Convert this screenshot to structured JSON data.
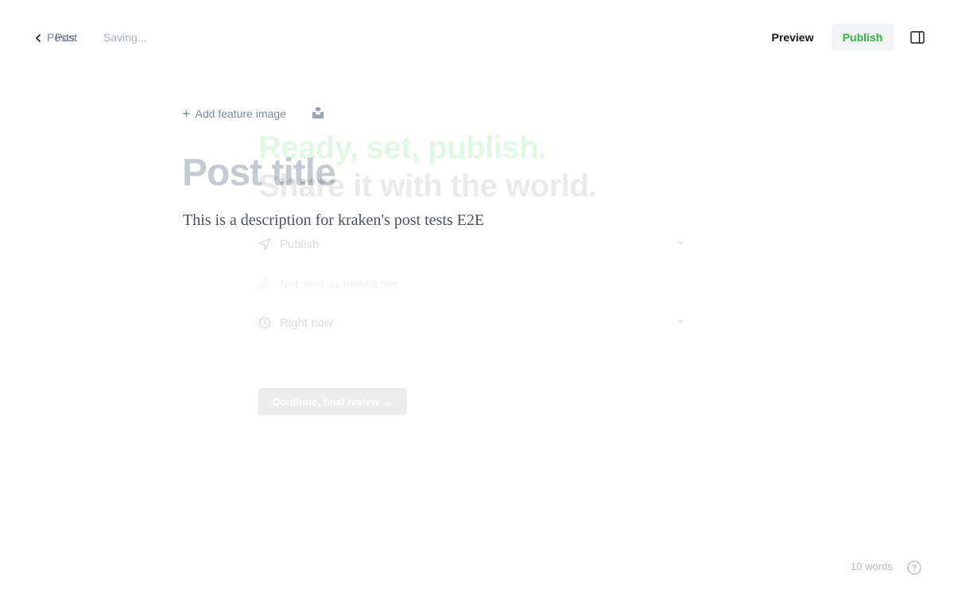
{
  "header": {
    "back_label_a": "Posts",
    "back_label_b": "Post",
    "save_status": "Saving...",
    "preview_label": "Preview",
    "publish_label": "Publish"
  },
  "editor": {
    "feature_image_label": "Add feature image",
    "title_placeholder": "Post title",
    "excerpt": "This is a description for kraken's post tests E2E"
  },
  "publish_flow": {
    "heading_line1": "Ready, set, publish.",
    "heading_line2": "Share it with the world.",
    "publish_type": "Publish",
    "newsletter": "Not sent as newsletter",
    "schedule": "Right now",
    "continue_label": "Continue, final review →"
  },
  "footer": {
    "word_count": "10 words"
  },
  "colors": {
    "accent": "#30cf43",
    "muted": "#7c8b9a",
    "title_placeholder": "#c5cbd2"
  },
  "icons": {
    "back": "chevron-left-icon",
    "settings": "sidebar-toggle-icon",
    "unsplash": "unsplash-icon",
    "help": "question-circle-icon"
  }
}
